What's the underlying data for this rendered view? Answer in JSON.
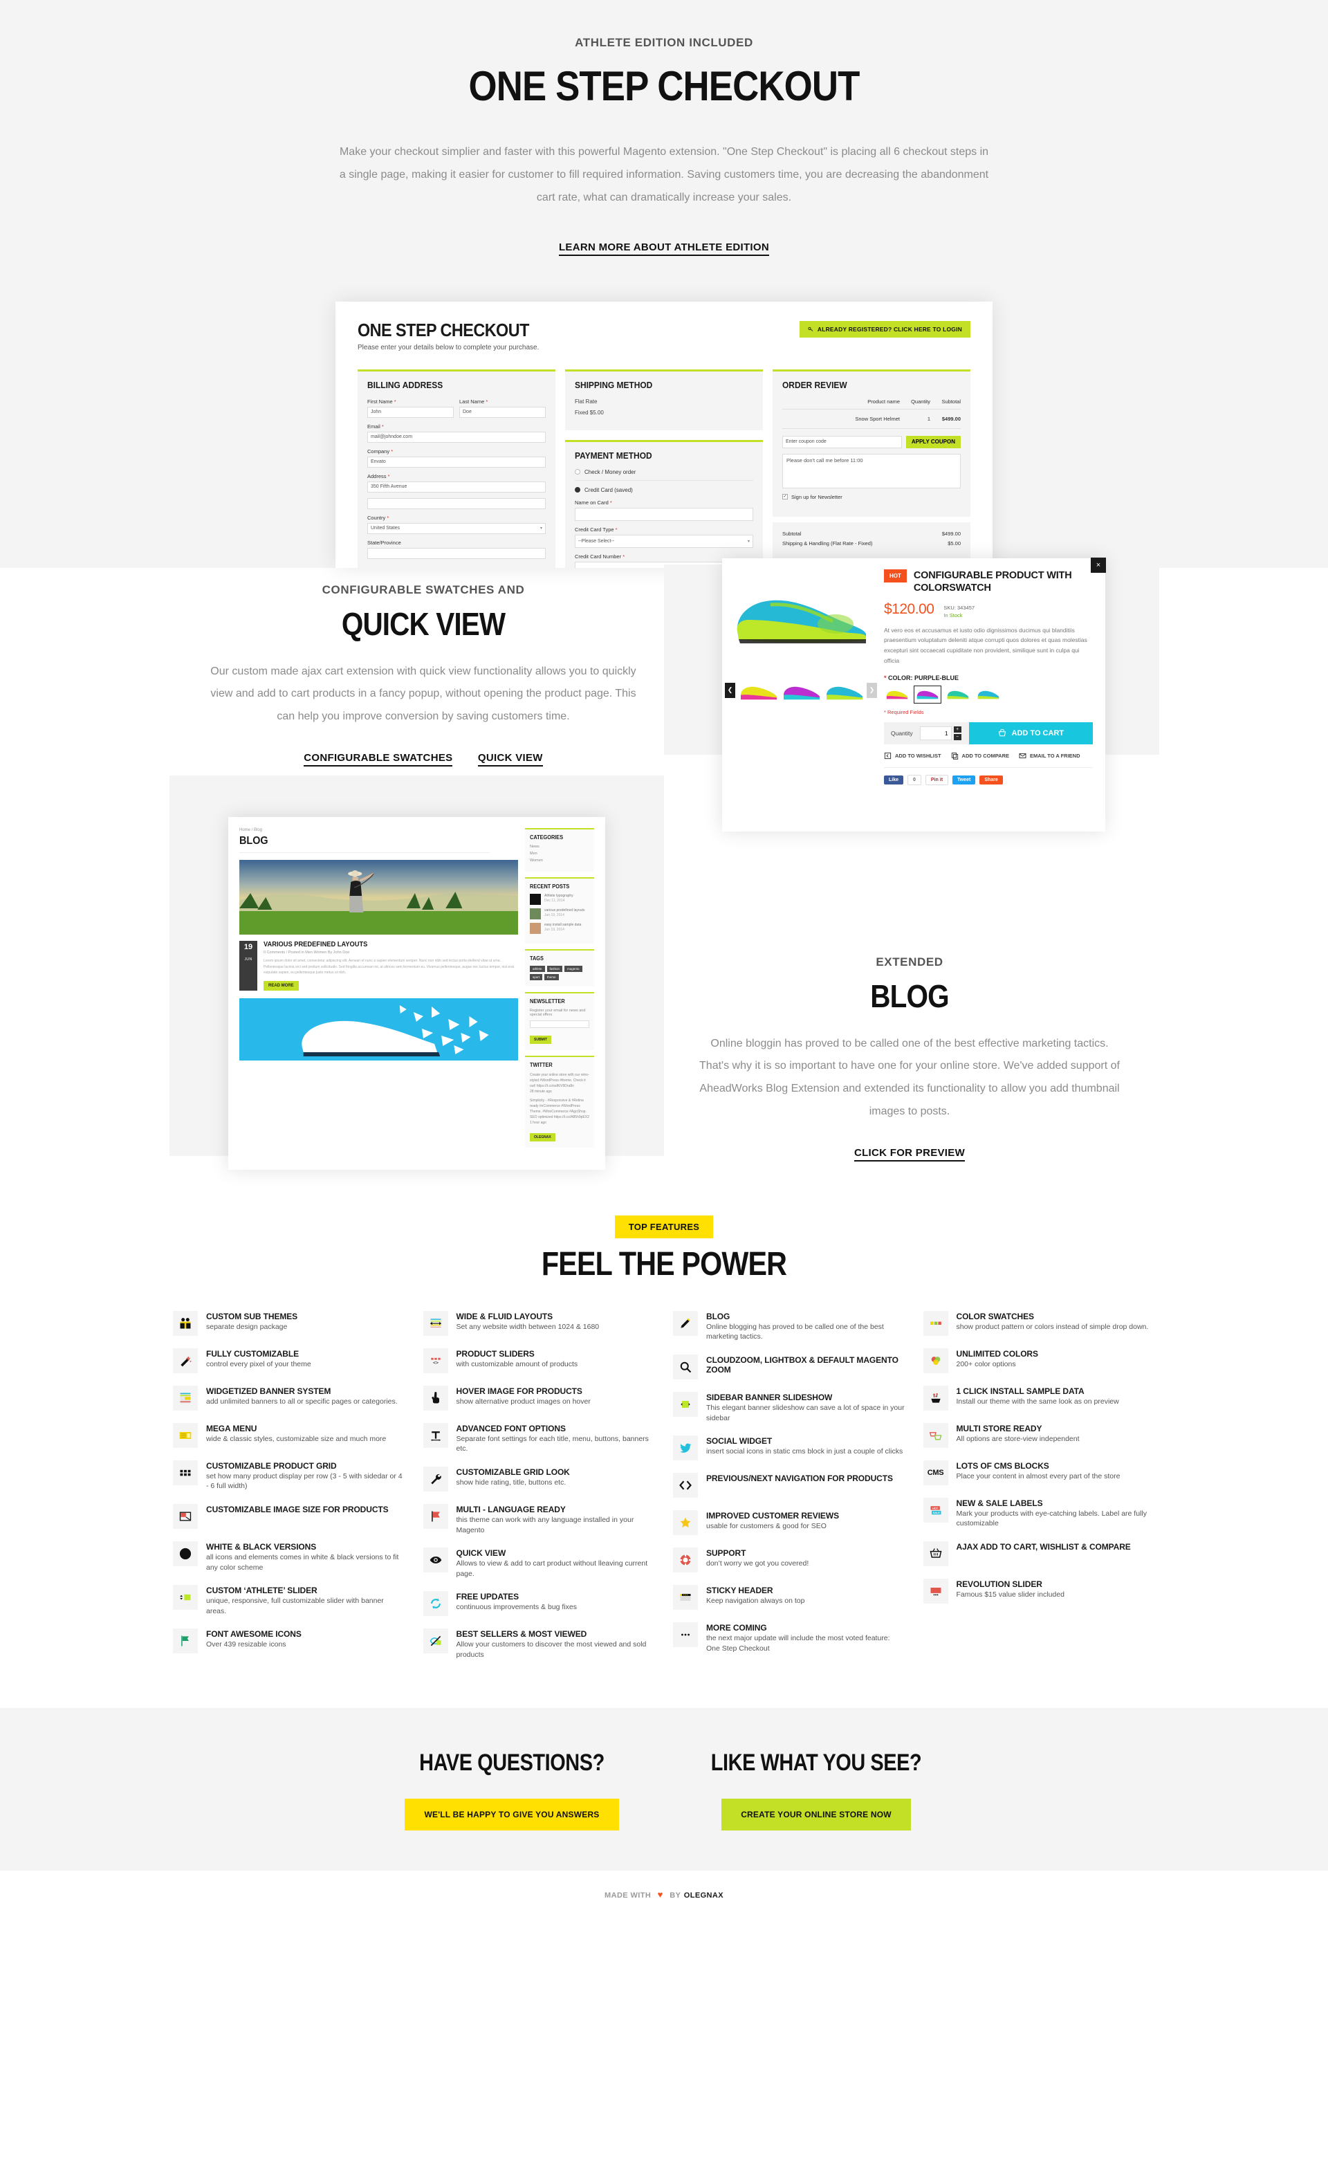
{
  "hero": {
    "eyebrow": "ATHLETE EDITION INCLUDED",
    "title": "ONE STEP CHECKOUT",
    "paragraph": "Make your checkout simplier and faster with this powerful Magento extension. \"One Step Checkout\" is placing all 6 checkout steps in a single page, making it easier for customer to fill required information. Saving customers time, you are decreasing the abandonment cart rate, what can dramatically increase your sales.",
    "link": "LEARN MORE ABOUT ATHLETE EDITION"
  },
  "checkout_shot": {
    "title": "ONE STEP CHECKOUT",
    "subtitle": "Please enter your details below to complete your purchase.",
    "login_button": "ALREADY REGISTERED? CLICK HERE TO LOGIN",
    "billing": {
      "heading": "BILLING ADDRESS",
      "first_name_label": "First Name",
      "first_name_value": "John",
      "last_name_label": "Last Name",
      "last_name_value": "Doe",
      "email_label": "Email",
      "email_value": "mail@johndoe.com",
      "company_label": "Company",
      "company_value": "Envato",
      "address_label": "Address",
      "address_value": "350 Fifth Avenue",
      "address2_value": "",
      "country_label": "Country",
      "country_value": "United States",
      "state_label": "State/Province"
    },
    "shipping": {
      "heading": "SHIPPING METHOD",
      "method": "Flat Rate",
      "price": "Fixed $5.00"
    },
    "payment": {
      "heading": "PAYMENT METHOD",
      "option_check": "Check / Money order",
      "option_card": "Credit Card (saved)",
      "name_on_card_label": "Name on Card",
      "card_type_label": "Credit Card Type",
      "card_type_value": "--Please Select--",
      "card_number_label": "Credit Card Number"
    },
    "review": {
      "heading": "ORDER REVIEW",
      "columns": [
        "Product name",
        "Quantity",
        "Subtotal"
      ],
      "rows": [
        [
          "Snow Sport Helmet",
          "1",
          "$499.00"
        ]
      ],
      "coupon_placeholder": "Enter coupon code",
      "apply_label": "APPLY COUPON",
      "comment": "Please don't call me before 11:00",
      "newsletter_label": "Sign up for Newsletter",
      "totals": [
        {
          "label": "Subtotal",
          "value": "$499.00"
        },
        {
          "label": "Shipping & Handling (Flat Rate - Fixed)",
          "value": "$5.00"
        }
      ]
    }
  },
  "quickview": {
    "eyebrow": "CONFIGURABLE SWATCHES AND",
    "title": "QUICK VIEW",
    "paragraph": "Our custom made ajax cart extension with quick view functionality allows you to quickly view and add to cart products in a fancy popup, without opening the product page. This can help you improve conversion by saving customers time.",
    "link1": "CONFIGURABLE SWATCHES",
    "link2": "QUICK VIEW"
  },
  "quickview_shot": {
    "badge": "HOT",
    "name": "CONFIGURABLE PRODUCT WITH COLORSWATCH",
    "price": "$120.00",
    "sku": "SKU: 343457",
    "stock": "In Stock",
    "description": "At vero eos et accusamus et iusto odio dignissimos ducimus qui blanditiis praesentium voluptatum deleniti atque corrupti quos dolores et quas molestias excepturi sint occaecati cupiditate non provident, similique sunt in culpa qui officia",
    "color_label": "COLOR: PURPLE-BLUE",
    "required_note": "* Required Fields",
    "quantity_label": "Quantity",
    "quantity_value": "1",
    "add_to_cart": "ADD TO CART",
    "actions": [
      "ADD TO WISHLIST",
      "ADD TO COMPARE",
      "EMAIL TO A FRIEND"
    ],
    "social": [
      "Like",
      "0",
      "Pin it",
      "Tweet",
      "Share"
    ],
    "close": "×"
  },
  "blog": {
    "eyebrow": "EXTENDED",
    "title": "BLOG",
    "paragraph": "Online bloggin has proved to be called one of the best effective marketing tactics. That's why it is so important to have one for your online store. We've added support of AheadWorks Blog Extension and extended its functionality to allow you add thumbnail images to posts.",
    "link": "CLICK FOR PREVIEW"
  },
  "blog_shot": {
    "breadcrumb": "Home / Blog",
    "heading": "BLOG",
    "post": {
      "day": "19",
      "month": "JUN",
      "title": "VARIOUS PREDEFINED LAYOUTS",
      "meta": "0 Comments   /   Posted in Men Women By John Doe",
      "body": "Lorem ipsum dolor sit amet, consectetur adipiscing elit. Aenean et nunc a sapien elementum semper. Nunc non nibh sed lectus porta eleifend vitae ut urna. Pellentesque lacinia orci sed pretium sollicitudin. Sed fringilla accumsan mi, at ultrices sem fermentum eu. Vivamus pellentesque, augue nec luctus tempor, nisl erat vulputate sapien, eu pellentesque justo metus ut nibh.",
      "read_more": "READ MORE"
    },
    "sidebar": {
      "categories_title": "CATEGORIES",
      "categories": [
        "News",
        "Men",
        "Women"
      ],
      "recent_title": "RECENT POSTS",
      "recent": [
        {
          "title": "Athlete typography",
          "date": "Dec 11, 2014"
        },
        {
          "title": "various predefined layouts",
          "date": "Jun 19, 2014"
        },
        {
          "title": "easy install sample data",
          "date": "Jun 19, 2014"
        }
      ],
      "tags_title": "TAGS",
      "tags": [
        "athlete",
        "fashion",
        "magento",
        "sport",
        "theme"
      ],
      "newsletter_title": "NEWSLETTER",
      "newsletter_text": "Register your email for news and special offers",
      "newsletter_button": "SUBMIT",
      "twitter_title": "TWITTER",
      "tweets": [
        {
          "text": "Create your online store with our retro-styled #WordPress #theme. Check it out! https://t.co/adKiV9Dra8n",
          "time": "28 minute ago"
        },
        {
          "text": "Simplicity - #Responsive & #Retina ready #eCommerce #WordPress Theme. #WooCommerce #AgoShop. SEO optimized https://t.co/A85h9pEX2",
          "time": "1 hour ago"
        }
      ],
      "twitter_handle": "OLEGNAX"
    }
  },
  "features": {
    "badge": "TOP FEATURES",
    "heading": "FEEL THE POWER",
    "columns": [
      [
        {
          "icon": "gift-icon",
          "title": "CUSTOM SUB THEMES",
          "desc": "separate design package"
        },
        {
          "icon": "magic-wand-icon",
          "title": "FULLY CUSTOMIZABLE",
          "desc": "control every pixel of your theme"
        },
        {
          "icon": "banner-layout-icon",
          "title": "WIDGETIZED BANNER SYSTEM",
          "desc": "add unlimited banners to all or specific pages or categories."
        },
        {
          "icon": "mega-menu-icon",
          "title": "MEGA MENU",
          "desc": "wide & classic styles, customizable size and much more"
        },
        {
          "icon": "grid-dots-icon",
          "title": "CUSTOMIZABLE PRODUCT GRID",
          "desc": "set how many product display per row (3 - 5 with sidedar or 4 - 6 full width)"
        },
        {
          "icon": "image-resize-icon",
          "title": "CUSTOMIZABLE IMAGE SIZE FOR PRODUCTS",
          "desc": ""
        },
        {
          "icon": "contrast-circle-icon",
          "title": "WHITE & BLACK VERSIONS",
          "desc": "all icons and elements comes in white & black versions to fit any color scheme"
        },
        {
          "icon": "slider-vertical-icon",
          "title": "CUSTOM ‘ATHLETE’ SLIDER",
          "desc": "unique, responsive, full customizable slider with banner areas."
        },
        {
          "icon": "flag-icon",
          "title": "FONT AWESOME ICONS",
          "desc": "Over 439 resizable icons"
        }
      ],
      [
        {
          "icon": "arrows-width-icon",
          "title": "WIDE & FLUID LAYOUTS",
          "desc": "Set any website width between 1024 & 1680"
        },
        {
          "icon": "slider-dots-icon",
          "title": "PRODUCT SLIDERS",
          "desc": "with customizable amount of products"
        },
        {
          "icon": "pointer-hand-icon",
          "title": "HOVER IMAGE FOR PRODUCTS",
          "desc": "show alternative product images on hover"
        },
        {
          "icon": "typography-icon",
          "title": "ADVANCED FONT OPTIONS",
          "desc": "Separate font settings for each title, menu, buttons, banners etc."
        },
        {
          "icon": "wrench-icon",
          "title": "CUSTOMIZABLE GRID LOOK",
          "desc": "show hide rating, title, buttons etc."
        },
        {
          "icon": "red-flag-icon",
          "title": "MULTI - LANGUAGE READY",
          "desc": "this theme can work with any language installed in your Magento"
        },
        {
          "icon": "eye-icon",
          "title": "QUICK VIEW",
          "desc": "Allows to view & add to cart product without lleaving current page."
        },
        {
          "icon": "refresh-icon",
          "title": "FREE UPDATES",
          "desc": "continuous improvements & bug fixes"
        },
        {
          "icon": "eye-slash-icon",
          "title": "BEST SELLERS & MOST VIEWED",
          "desc": "Allow your customers to discover the most viewed and sold products"
        }
      ],
      [
        {
          "icon": "pencil-icon",
          "title": "BLOG",
          "desc": "Online blogging has proved to be called one of the best marketing tactics."
        },
        {
          "icon": "search-icon",
          "title": "CLOUDZOOM, LIGHTBOX & DEFAULT MAGENTO ZOOM",
          "desc": ""
        },
        {
          "icon": "banner-slideshow-icon",
          "title": "SIDEBAR BANNER SLIDESHOW",
          "desc": "This elegant banner slideshow can save a lot of space in your sidebar"
        },
        {
          "icon": "twitter-bird-icon",
          "title": "SOCIAL WIDGET",
          "desc": "insert social icons in static cms block in just a couple of clicks"
        },
        {
          "icon": "prev-next-icon",
          "title": "PREVIOUS/NEXT NAVIGATION FOR PRODUCTS",
          "desc": ""
        },
        {
          "icon": "star-icon",
          "title": "IMPROVED CUSTOMER REVIEWS",
          "desc": "usable for customers & good for SEO"
        },
        {
          "icon": "lifebuoy-icon",
          "title": "SUPPORT",
          "desc": "don’t worry we got you covered!"
        },
        {
          "icon": "sticky-header-icon",
          "title": "STICKY HEADER",
          "desc": "Keep navigation always on top"
        },
        {
          "icon": "ellipsis-icon",
          "title": "MORE COMING",
          "desc": "the next major update will include the most voted feature: One Step Checkout"
        }
      ],
      [
        {
          "icon": "color-swatches-icon",
          "title": "COLOR SWATCHES",
          "desc": "show product pattern or colors instead of simple drop down."
        },
        {
          "icon": "color-circles-icon",
          "title": "UNLIMITED COLORS",
          "desc": "200+ color options"
        },
        {
          "icon": "install-icon",
          "title": "1 CLICK INSTALL SAMPLE DATA",
          "desc": "Install our theme with the same look as on preview"
        },
        {
          "icon": "multi-basket-icon",
          "title": "MULTI STORE READY",
          "desc": "All options are store-view independent"
        },
        {
          "icon": "cms-icon",
          "title": "LOTS OF CMS BLOCKS",
          "desc": "Place your content in almost every part of the store"
        },
        {
          "icon": "labels-icon",
          "title": "NEW & SALE LABELS",
          "desc": "Mark your products with eye-catching labels. Label are fully customizable"
        },
        {
          "icon": "basket-icon",
          "title": "AJAX ADD TO CART, WISHLIST & COMPARE",
          "desc": ""
        },
        {
          "icon": "revolution-slider-icon",
          "title": "REVOLUTION SLIDER",
          "desc": "Famous $15 value slider included"
        }
      ]
    ]
  },
  "cta": {
    "left_heading": "HAVE QUESTIONS?",
    "left_button": "WE'LL BE HAPPY TO GIVE YOU ANSWERS",
    "right_heading": "LIKE WHAT YOU SEE?",
    "right_button": "CREATE YOUR ONLINE STORE NOW"
  },
  "footer": {
    "prefix": "MADE WITH",
    "heart": "♥",
    "middle": "BY",
    "brand": "OLEGNAX"
  },
  "colors": {
    "lime": "#c3df26",
    "yellow": "#ffe000",
    "orange": "#f4511e",
    "cyan": "#18c7de",
    "bg_gray": "#f4f4f4"
  }
}
